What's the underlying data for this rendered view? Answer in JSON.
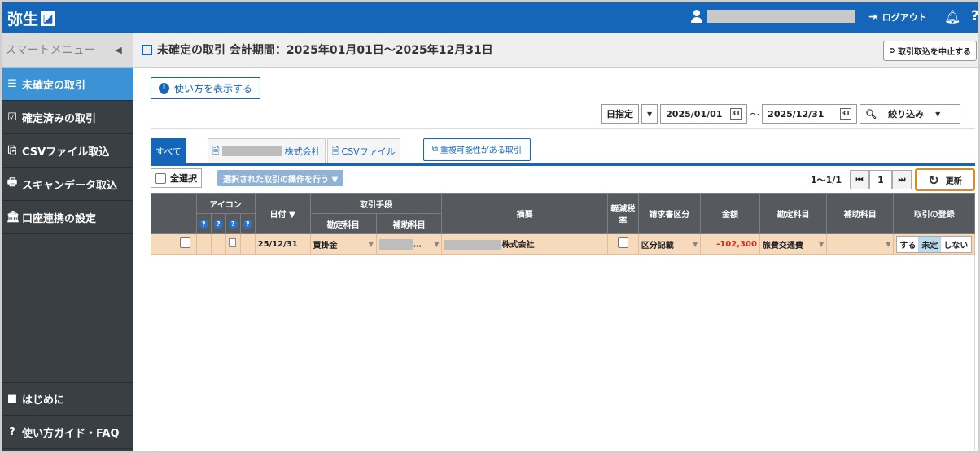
{
  "header": {
    "logo_text": "弥生",
    "logo_box": "ᴚ",
    "logout_label": "ログアウト",
    "help_glyph": "?"
  },
  "sidebar": {
    "smart_menu_label": "スマートメニュー",
    "collapse_glyph": "◀",
    "items": [
      {
        "label": "未確定の取引",
        "icon": "☰"
      },
      {
        "label": "確定済みの取引",
        "icon": "☑"
      },
      {
        "label": "CSVファイル取込",
        "icon": "⎘"
      },
      {
        "label": "スキャンデータ取込",
        "icon": "🖶"
      },
      {
        "label": "口座連携の設定",
        "icon": "🏛"
      }
    ],
    "bottom_items": [
      {
        "label": "はじめに",
        "icon": "■"
      },
      {
        "label": "使い方ガイド・FAQ",
        "icon": "?"
      }
    ]
  },
  "main": {
    "title": "未確定の取引 会計期間：2025年01月01日～2025年12月31日",
    "stop_import_label": "取引取込を中止する",
    "howto_label": "使い方を表示する",
    "filter": {
      "date_mode": "日指定",
      "date_from": "2025/01/01",
      "tilde": "～",
      "date_to": "2025/12/31",
      "narrow_label": "絞り込み"
    },
    "tabs": {
      "all": "すべて",
      "company_suffix": "株式会社",
      "csv": "CSVファイル",
      "duplicate": "重複可能性がある取引"
    },
    "toolbar": {
      "select_all": "全選択",
      "bulk_action": "選択された取引の操作を行う ▼",
      "page_count": "1～1/1",
      "page_num": "1",
      "first": "⏮",
      "last": "⏭",
      "refresh": "更新"
    },
    "table": {
      "headers": {
        "icon": "アイコン",
        "date": "日付 ▼",
        "method": "取引手段",
        "method_account": "勘定科目",
        "method_sub": "補助科目",
        "summary": "摘要",
        "reduced_tax": "軽減税率",
        "invoice": "請求書区分",
        "amount": "金額",
        "account": "勘定科目",
        "sub_account": "補助科目",
        "register": "取引の登録"
      },
      "rows": [
        {
          "date": "25/12/31",
          "method_account": "買掛金",
          "method_sub": "…",
          "summary_suffix": "株式会社",
          "invoice": "区分記載",
          "amount": "-102,300",
          "account": "旅費交通費",
          "reg_yes": "する",
          "reg_pending": "未定",
          "reg_no": "しない"
        }
      ]
    }
  }
}
